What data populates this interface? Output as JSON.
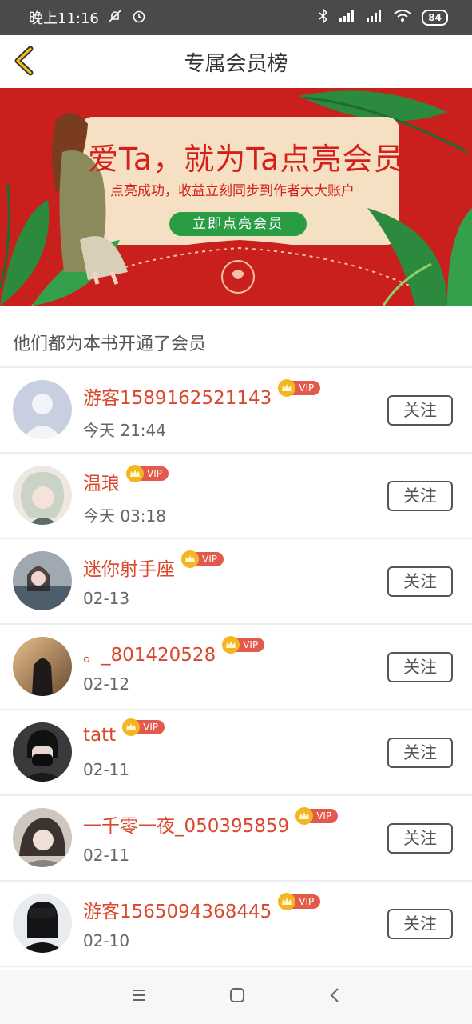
{
  "statusbar": {
    "time": "晚上11:16",
    "battery": "84"
  },
  "header": {
    "title": "专属会员榜"
  },
  "banner": {
    "title": "爱Ta，就为Ta点亮会员",
    "subtitle": "点亮成功，收益立刻同步到作者大大账户",
    "button": "立即点亮会员"
  },
  "section_title": "他们都为本书开通了会员",
  "vip_label": "VIP",
  "follow_label": "关注",
  "members": [
    {
      "name": "游客1589162521143",
      "time": "今天 21:44",
      "avatar_color": "#c8cfe0"
    },
    {
      "name": "温琅",
      "time": "今天 03:18",
      "avatar_color": "#d9c9c6"
    },
    {
      "name": "迷你射手座",
      "time": "02-13",
      "avatar_color": "#8a7f86"
    },
    {
      "name": "。_801420528",
      "time": "02-12",
      "avatar_color": "#b98a5a"
    },
    {
      "name": "tatt",
      "time": "02-11",
      "avatar_color": "#2c2c2e"
    },
    {
      "name": "一千零一夜_050395859",
      "time": "02-11",
      "avatar_color": "#7d7470"
    },
    {
      "name": "游客1565094368445",
      "time": "02-10",
      "avatar_color": "#1f1f22"
    }
  ],
  "colors": {
    "accent": "#d9482c",
    "banner_bg": "#c9201d",
    "button_green": "#2a9d44"
  }
}
